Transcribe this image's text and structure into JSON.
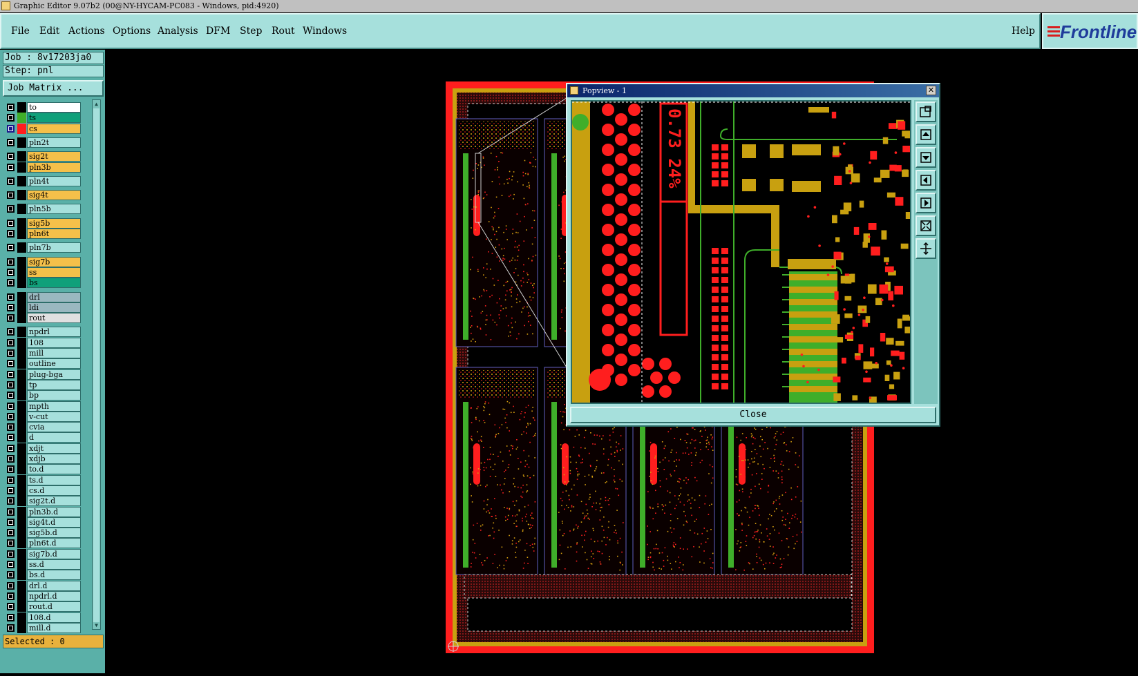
{
  "window": {
    "title": "Graphic Editor 9.07b2 (00@NY-HYCAM-PC083 - Windows, pid:4920)"
  },
  "menubar": {
    "items": [
      "File",
      "Edit",
      "Actions",
      "Options",
      "Analysis",
      "DFM",
      "Step",
      "Rout",
      "Windows"
    ],
    "help": "Help",
    "brand": "Frontline"
  },
  "job": {
    "job_line": "Job : 8v17203ja0",
    "step_line": "Step: pnl",
    "matrix_button": "Job Matrix ..."
  },
  "layers": [
    {
      "name": "to",
      "color": "#ffffff",
      "swatch": "#000000"
    },
    {
      "name": "ts",
      "color": "#10a07a",
      "swatch": "#3fae2a"
    },
    {
      "name": "cs",
      "color": "#f5c04a",
      "swatch": "#ff1e1e",
      "selected": true
    },
    {
      "name": "pln2t",
      "color": "#a6e0dc",
      "swatch": "#000000"
    },
    {
      "name": "sig2t",
      "color": "#f5c04a",
      "swatch": "#000000"
    },
    {
      "name": "pln3b",
      "color": "#f5c04a",
      "swatch": "#000000"
    },
    {
      "name": "pln4t",
      "color": "#a6e0dc",
      "swatch": "#000000"
    },
    {
      "name": "sig4t",
      "color": "#f5c04a",
      "swatch": "#000000"
    },
    {
      "name": "pln5b",
      "color": "#a6e0dc",
      "swatch": "#000000"
    },
    {
      "name": "sig5b",
      "color": "#f5c04a",
      "swatch": "#000000"
    },
    {
      "name": "pln6t",
      "color": "#f5c04a",
      "swatch": "#000000"
    },
    {
      "name": "pln7b",
      "color": "#a6e0dc",
      "swatch": "#000000"
    },
    {
      "name": "sig7b",
      "color": "#f5c04a",
      "swatch": "#000000"
    },
    {
      "name": "ss",
      "color": "#f5c04a",
      "swatch": "#000000"
    },
    {
      "name": "bs",
      "color": "#10a07a",
      "swatch": "#000000"
    },
    {
      "name": "drl",
      "color": "#9ab8c0",
      "swatch": "#000000"
    },
    {
      "name": "ldi",
      "color": "#9ab8c0",
      "swatch": "#000000"
    },
    {
      "name": "rout",
      "color": "#e0e0e0",
      "swatch": "#000000"
    },
    {
      "name": "npdrl",
      "color": "#a6e0dc",
      "swatch": "#000000"
    },
    {
      "name": "108",
      "color": "#a6e0dc",
      "swatch": "#000000"
    },
    {
      "name": "mill",
      "color": "#a6e0dc",
      "swatch": "#000000"
    },
    {
      "name": "outline",
      "color": "#a6e0dc",
      "swatch": "#000000"
    },
    {
      "name": "plug-bga",
      "color": "#a6e0dc",
      "swatch": "#000000"
    },
    {
      "name": "tp",
      "color": "#a6e0dc",
      "swatch": "#000000"
    },
    {
      "name": "bp",
      "color": "#a6e0dc",
      "swatch": "#000000"
    },
    {
      "name": "mpth",
      "color": "#a6e0dc",
      "swatch": "#000000"
    },
    {
      "name": "v-cut",
      "color": "#a6e0dc",
      "swatch": "#000000"
    },
    {
      "name": "cvia",
      "color": "#a6e0dc",
      "swatch": "#000000"
    },
    {
      "name": "d",
      "color": "#a6e0dc",
      "swatch": "#000000"
    },
    {
      "name": "xdjt",
      "color": "#a6e0dc",
      "swatch": "#000000"
    },
    {
      "name": "xdjb",
      "color": "#a6e0dc",
      "swatch": "#000000"
    },
    {
      "name": "to.d",
      "color": "#a6e0dc",
      "swatch": "#000000"
    },
    {
      "name": "ts.d",
      "color": "#a6e0dc",
      "swatch": "#000000"
    },
    {
      "name": "cs.d",
      "color": "#a6e0dc",
      "swatch": "#000000"
    },
    {
      "name": "sig2t.d",
      "color": "#a6e0dc",
      "swatch": "#000000"
    },
    {
      "name": "pln3b.d",
      "color": "#a6e0dc",
      "swatch": "#000000"
    },
    {
      "name": "sig4t.d",
      "color": "#a6e0dc",
      "swatch": "#000000"
    },
    {
      "name": "sig5b.d",
      "color": "#a6e0dc",
      "swatch": "#000000"
    },
    {
      "name": "pln6t.d",
      "color": "#a6e0dc",
      "swatch": "#000000"
    },
    {
      "name": "sig7b.d",
      "color": "#a6e0dc",
      "swatch": "#000000"
    },
    {
      "name": "ss.d",
      "color": "#a6e0dc",
      "swatch": "#000000"
    },
    {
      "name": "bs.d",
      "color": "#a6e0dc",
      "swatch": "#000000"
    },
    {
      "name": "drl.d",
      "color": "#a6e0dc",
      "swatch": "#000000"
    },
    {
      "name": "npdrl.d",
      "color": "#a6e0dc",
      "swatch": "#000000"
    },
    {
      "name": "rout.d",
      "color": "#a6e0dc",
      "swatch": "#000000"
    },
    {
      "name": "108.d",
      "color": "#a6e0dc",
      "swatch": "#000000"
    },
    {
      "name": "mill.d",
      "color": "#a6e0dc",
      "swatch": "#000000"
    }
  ],
  "status": {
    "selected": "Selected : 0"
  },
  "popview": {
    "title": "Popview - 1",
    "close_label": "Close",
    "close_x": "✕",
    "marking_text": "0.73 24%",
    "tools": [
      "zoom-window-icon",
      "pan-up-icon",
      "pan-down-icon",
      "pan-left-icon",
      "pan-right-icon",
      "zoom-fit-icon",
      "zoom-in-out-icon"
    ]
  },
  "colors": {
    "menu_bg": "#a6e0dc",
    "panel_bg": "#5ab0a8",
    "copper": "#c8a010",
    "trace_red": "#ff1e1e",
    "mask_green": "#3fae2a",
    "board_frame": "#ff1e1e"
  }
}
